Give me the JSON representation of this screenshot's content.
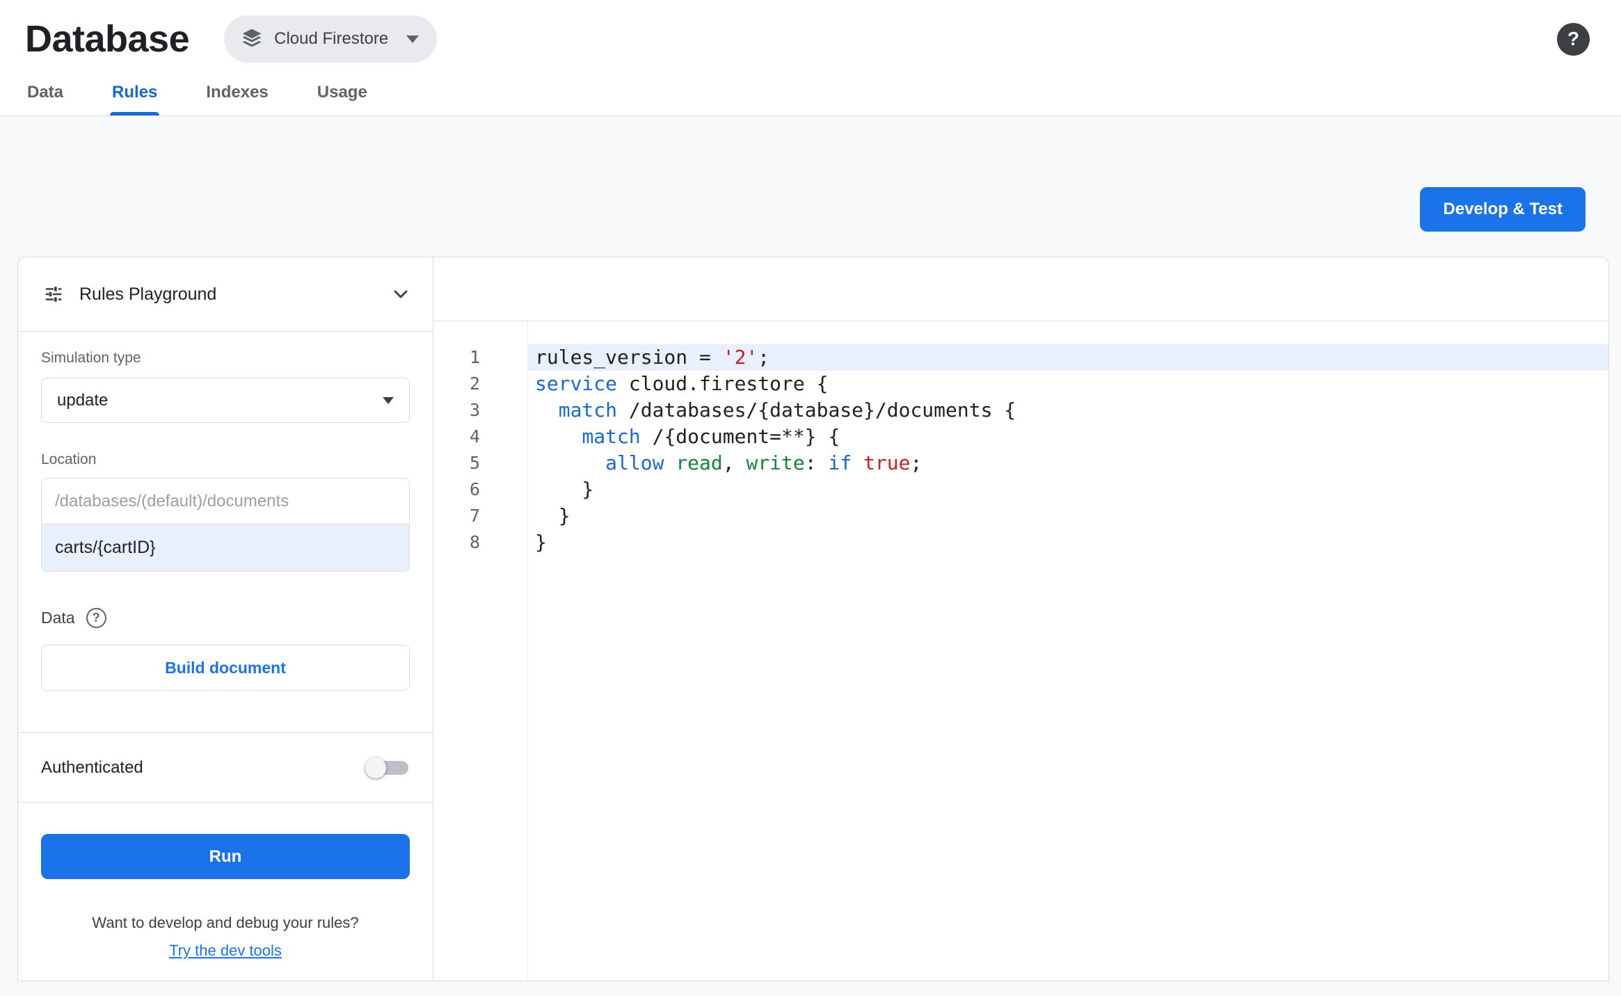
{
  "header": {
    "title": "Database",
    "product": "Cloud Firestore",
    "help_glyph": "?"
  },
  "tabs": [
    {
      "label": "Data",
      "active": false
    },
    {
      "label": "Rules",
      "active": true
    },
    {
      "label": "Indexes",
      "active": false
    },
    {
      "label": "Usage",
      "active": false
    }
  ],
  "toolbar": {
    "develop_test": "Develop & Test"
  },
  "playground": {
    "title": "Rules Playground",
    "simulation_type_label": "Simulation type",
    "simulation_type_value": "update",
    "location_label": "Location",
    "location_placeholder": "/databases/(default)/documents",
    "location_value": "carts/{cartID}",
    "data_label": "Data",
    "data_help_glyph": "?",
    "build_document_button": "Build document",
    "authenticated_label": "Authenticated",
    "authenticated_on": false,
    "run_button": "Run",
    "dev_tools_text": "Want to develop and debug your rules?",
    "dev_tools_link": "Try the dev tools"
  },
  "editor": {
    "lines": [
      {
        "highlight": true,
        "tokens": [
          [
            "rules_version = ",
            "plain"
          ],
          [
            "'2'",
            "string"
          ],
          [
            ";",
            "plain"
          ]
        ]
      },
      {
        "highlight": false,
        "tokens": [
          [
            "service ",
            "keyword"
          ],
          [
            "cloud.firestore {",
            "plain"
          ]
        ]
      },
      {
        "highlight": false,
        "tokens": [
          [
            "  ",
            "plain"
          ],
          [
            "match ",
            "keyword"
          ],
          [
            "/databases/{database}/documents {",
            "plain"
          ]
        ]
      },
      {
        "highlight": false,
        "tokens": [
          [
            "    ",
            "plain"
          ],
          [
            "match ",
            "keyword"
          ],
          [
            "/{document=**} {",
            "plain"
          ]
        ]
      },
      {
        "highlight": false,
        "tokens": [
          [
            "      ",
            "plain"
          ],
          [
            "allow ",
            "keyword"
          ],
          [
            "read",
            "perm"
          ],
          [
            ", ",
            "plain"
          ],
          [
            "write",
            "perm"
          ],
          [
            ": ",
            "plain"
          ],
          [
            "if ",
            "keyword"
          ],
          [
            "true",
            "bool"
          ],
          [
            ";",
            "plain"
          ]
        ]
      },
      {
        "highlight": false,
        "tokens": [
          [
            "    }",
            "plain"
          ]
        ]
      },
      {
        "highlight": false,
        "tokens": [
          [
            "  }",
            "plain"
          ]
        ]
      },
      {
        "highlight": false,
        "tokens": [
          [
            "}",
            "plain"
          ]
        ]
      }
    ]
  },
  "colors": {
    "accent": "#1a73e8",
    "active_tab": "#1967d2",
    "keyword": "#1967d2",
    "string": "#c5221f",
    "permission": "#188038",
    "line_highlight": "#e9f0fd",
    "location_focus_bg": "#e8f0fe"
  }
}
